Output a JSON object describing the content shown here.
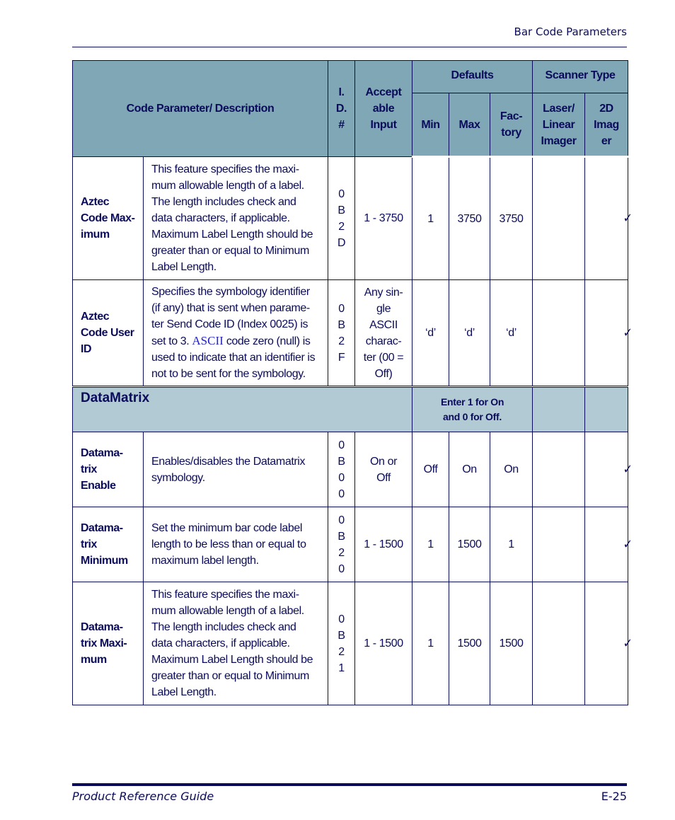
{
  "header": {
    "section_title": "Bar Code Parameters"
  },
  "table": {
    "columns": {
      "code_param": "Code Parameter/ Description",
      "id": [
        "I.",
        "D.",
        "#"
      ],
      "acceptable_input": [
        "Accept",
        "able",
        "Input"
      ],
      "defaults": "Defaults",
      "min": "Min",
      "max": "Max",
      "factory": [
        "Fac-",
        "tory"
      ],
      "scanner_type": "Scanner Type",
      "laser": [
        "Laser/",
        "Linear",
        "Imager"
      ],
      "imager2d": [
        "2D",
        "Imag",
        "er"
      ]
    },
    "rows_aztec": [
      {
        "name": [
          "Aztec",
          "Code Max-",
          "imum"
        ],
        "description": [
          "This feature specifies the maxi-",
          "mum allowable length of a label.",
          "The length includes check and",
          "data characters, if applicable.",
          "Maximum Label Length should be",
          "greater than or equal to Minimum",
          "Label Length."
        ],
        "id": [
          "0",
          "B",
          "2",
          "D"
        ],
        "input": [
          "1 - 3750"
        ],
        "min": "1",
        "max": "3750",
        "factory": "3750",
        "laser": "",
        "imager2d": "✓"
      },
      {
        "name": [
          "Aztec",
          "Code User",
          "ID"
        ],
        "description_parts": {
          "l1": "Specifies the symbology identifier",
          "l2": "(if any) that is sent when parame-",
          "l3": "ter Send Code ID (Index 0025) is",
          "l4_pre": "set to 3. ",
          "l4_ascii": "ASCII",
          "l4_post": " code zero (null) is",
          "l5": "used to indicate that an identifier is",
          "l6": "not to be sent for the symbology."
        },
        "id": [
          "0",
          "B",
          "2",
          "F"
        ],
        "input": [
          "Any sin-",
          "gle",
          "ASCII",
          "charac-",
          "ter (00 =",
          "Off)"
        ],
        "min": "‘d’",
        "max": "‘d’",
        "factory": "‘d’",
        "laser": "",
        "imager2d": "✓"
      }
    ],
    "section": {
      "title": "DataMatrix",
      "note": [
        "Enter 1 for On",
        "and 0 for Off."
      ]
    },
    "rows_datamatrix": [
      {
        "name": [
          "Datama-",
          "trix",
          "Enable"
        ],
        "description": [
          "Enables/disables the Datamatrix",
          "symbology."
        ],
        "id": [
          "0",
          "B",
          "0",
          "0"
        ],
        "input": [
          "On or",
          "Off"
        ],
        "min": "Off",
        "max": "On",
        "factory": "On",
        "laser": "",
        "imager2d": "✓"
      },
      {
        "name": [
          "Datama-",
          "trix",
          "Minimum"
        ],
        "description": [
          "Set the minimum bar code label",
          "length to be less than or equal to",
          "maximum label length."
        ],
        "id": [
          "0",
          "B",
          "2",
          "0"
        ],
        "input": [
          "1 - 1500"
        ],
        "min": "1",
        "max": "1500",
        "factory": "1",
        "laser": "",
        "imager2d": "✓"
      },
      {
        "name": [
          "Datama-",
          "trix Maxi-",
          "mum"
        ],
        "description": [
          "This feature specifies the maxi-",
          "mum allowable length of a label.",
          "The length includes check and",
          "data characters, if applicable.",
          "Maximum Label Length should be",
          "greater than or equal to Minimum",
          "Label Length."
        ],
        "id": [
          "0",
          "B",
          "2",
          "1"
        ],
        "input": [
          "1 - 1500"
        ],
        "min": "1",
        "max": "1500",
        "factory": "1500",
        "laser": "",
        "imager2d": "✓"
      }
    ]
  },
  "footer": {
    "guide_title": "Product Reference Guide",
    "page_number": "E-25"
  },
  "colors": {
    "text": "#0b0b5c",
    "header_bg": "#7fa7b6",
    "section_bg": "#b2cad3",
    "ascii_link": "#2323c8"
  }
}
